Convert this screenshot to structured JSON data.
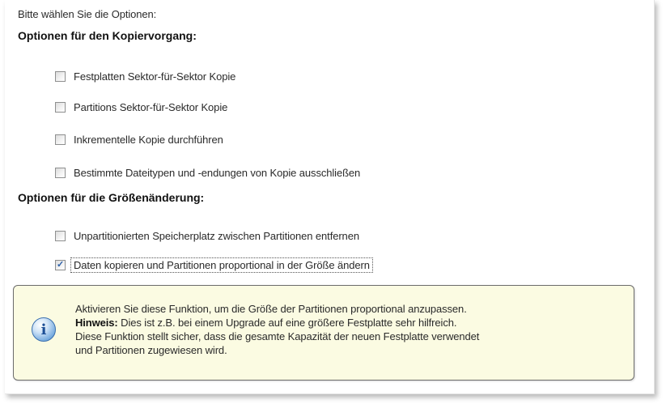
{
  "intro": "Bitte wählen Sie die Optionen:",
  "copy_section": {
    "title": "Optionen für den Kopiervorgang:",
    "options": [
      {
        "label": "Festplatten Sektor-für-Sektor Kopie",
        "checked": false
      },
      {
        "label": "Partitions Sektor-für-Sektor Kopie",
        "checked": false
      },
      {
        "label": "Inkrementelle Kopie durchführen",
        "checked": false
      },
      {
        "label": "Bestimmte Dateitypen und -endungen von Kopie ausschließen",
        "checked": false
      }
    ]
  },
  "resize_section": {
    "title": "Optionen für die Größenänderung:",
    "options": [
      {
        "label": "Unpartitionierten Speicherplatz zwischen Partitionen entfernen",
        "checked": false
      },
      {
        "label": "Daten kopieren und Partitionen proportional in der Größe ändern",
        "checked": true
      }
    ]
  },
  "hint": {
    "icon": "info-icon",
    "icon_glyph": "i",
    "line1": "Aktivieren Sie diese Funktion, um die Größe der Partitionen proportional anzupassen.",
    "label": "Hinweis:",
    "line2": " Dies ist z.B. bei einem Upgrade auf eine größere Festplatte sehr hilfreich.",
    "line3": "Diese Funktion stellt sicher, dass die gesamte Kapazität der neuen Festplatte verwendet",
    "line4": "und Partitionen zugewiesen wird."
  },
  "colors": {
    "hint_background": "#fbfbe2",
    "check_mark": "#2b5fa8",
    "icon_blue": "#3f7dc0"
  }
}
